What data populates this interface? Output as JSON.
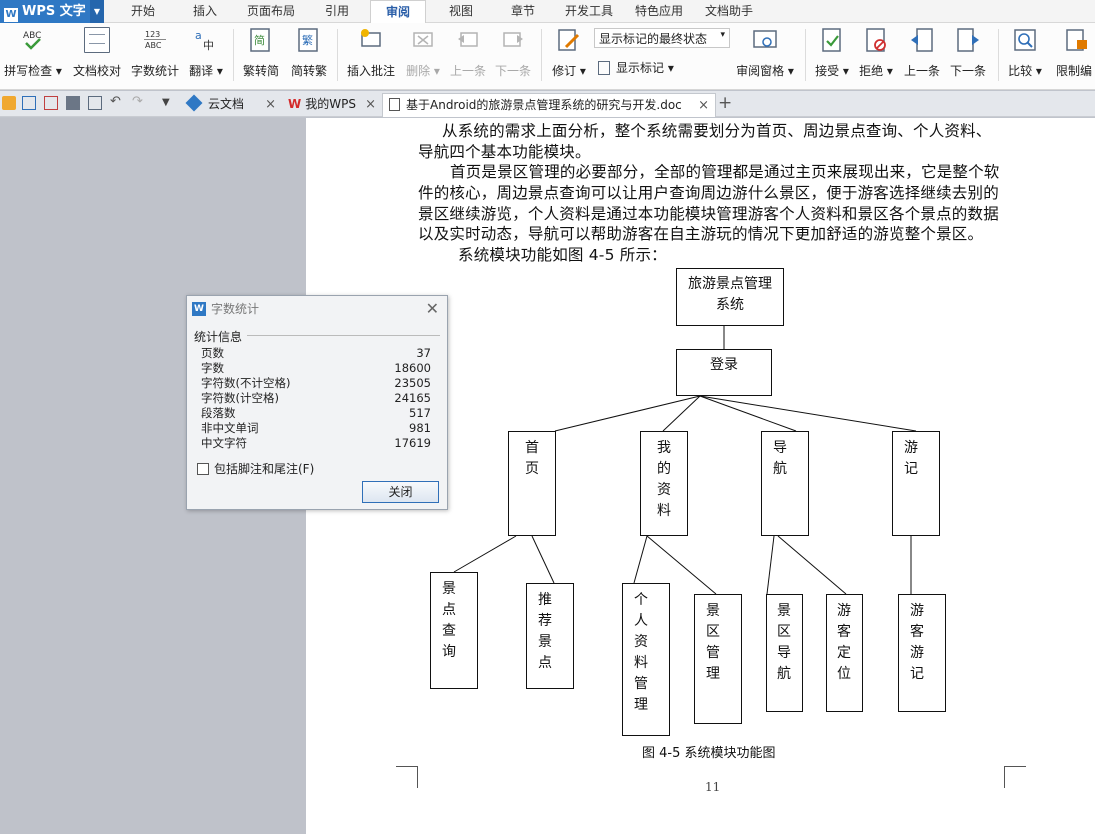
{
  "app": {
    "name": "WPS 文字"
  },
  "menu": [
    "开始",
    "插入",
    "页面布局",
    "引用",
    "审阅",
    "视图",
    "章节",
    "开发工具",
    "特色应用",
    "文档助手"
  ],
  "active_menu": "审阅",
  "ribbon": {
    "spell_check": "拼写检查",
    "doc_proof": "文档校对",
    "word_count": "字数统计",
    "translate": "翻译",
    "to_traditional": "繁转简",
    "to_simplified": "简转繁",
    "insert_comment": "插入批注",
    "delete": "删除",
    "prev_comment": "上一条",
    "next_comment": "下一条",
    "revise": "修订",
    "markup_state": "显示标记的最终状态",
    "show_markup": "显示标记",
    "review_pane": "审阅窗格",
    "accept": "接受",
    "reject": "拒绝",
    "prev_change": "上一条",
    "next_change": "下一条",
    "compare": "比较",
    "restrict": "限制编"
  },
  "tabs": {
    "cloud": "云文档",
    "mywps": "我的WPS",
    "doc": "基于Android的旅游景点管理系统的研究与开发.doc"
  },
  "doc": {
    "lines": [
      "从系统的需求上面分析，整个系统需要划分为首页、周边景点查询、个人资料、",
      "导航四个基本功能模块。",
      "首页是景区管理的必要部分，全部的管理都是通过主页来展现出来，它是整个软",
      "件的核心，周边景点查询可以让用户查询周边游什么景区，便于游客选择继续去别的",
      "景区继续游览，个人资料是通过本功能模块管理游客个人资料和景区各个景点的数据",
      "以及实时动态，导航可以帮助游客在自主游玩的情况下更加舒适的游览整个景区。",
      "系统模块功能如图 4-5 所示："
    ],
    "caption": "图 4-5 系统模块功能图",
    "page_number": "11"
  },
  "diagram": {
    "root": [
      "旅游景点管理",
      "系统"
    ],
    "login": "登录",
    "modules": [
      "首页",
      "我的资料",
      "导航",
      "游记"
    ],
    "leaves": [
      "景点查询",
      "推荐景点",
      "个人资料管理",
      "景区管理",
      "景区导航",
      "游客定位",
      "游客游记"
    ]
  },
  "dialog": {
    "title": "字数统计",
    "section": "统计信息",
    "stats": [
      {
        "label": "页数",
        "value": "37"
      },
      {
        "label": "字数",
        "value": "18600"
      },
      {
        "label": "字符数(不计空格)",
        "value": "23505"
      },
      {
        "label": "字符数(计空格)",
        "value": "24165"
      },
      {
        "label": "段落数",
        "value": "517"
      },
      {
        "label": "非中文单词",
        "value": "981"
      },
      {
        "label": "中文字符",
        "value": "17619"
      }
    ],
    "include_footnotes": "包括脚注和尾注(F)",
    "close": "关闭"
  }
}
